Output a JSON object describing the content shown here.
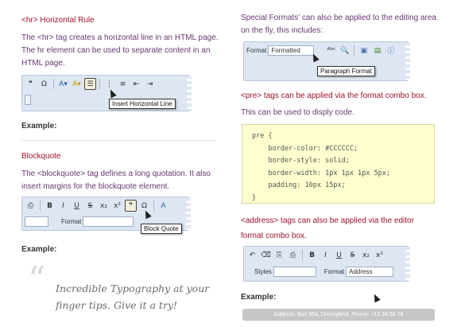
{
  "left": {
    "hr": {
      "heading": "<hr> Horizontal Rule",
      "para1": "The <hr> tag creates a horizontal line in an HTML page.",
      "para2": "The hr element can be used to separate content in an",
      "para3": "HTML page.",
      "tooltip": "Insert Horizontal Line",
      "example": "Example:"
    },
    "blockquote": {
      "heading": "Blockquote",
      "para1": "The <blockquote> tag defines a long quotation. It also",
      "para2": "insert margins for the blockquote element.",
      "format_label": "Format",
      "tooltip": "Block Quote",
      "example": "Example:"
    },
    "quote": {
      "mark": "“",
      "line1": "Incredible Typography at your",
      "line2": "finger tips. Give it a try!"
    }
  },
  "right": {
    "special": {
      "para1": "Special Formats' can also be applied to the editing area",
      "para2": "on the fly, this includes:",
      "format_label": "Format",
      "format_value": "Formatted",
      "tooltip": "Paragraph Format"
    },
    "pre": {
      "heading": "<pre> tags can be applied via the format combo box.",
      "para": "This can be used to disply code.",
      "code": [
        "pre {",
        "    border-color: #CCCCCC;",
        "    border-style: solid;",
        "    border-width: 1px 1px 1px 5px;",
        "    padding: 10px 15px;",
        "}"
      ]
    },
    "address": {
      "heading1": "<address> tags can also be applied via the editor",
      "heading2": "format combo box.",
      "styles_label": "Styles",
      "format_label": "Format",
      "format_value": "Address",
      "example": "Example:",
      "bar_text": "Address: Box 564, Disneyland, Phone: +12 34 56 78"
    }
  },
  "colors": {
    "heading": "#a0112a",
    "para": "#6a3574",
    "code_bg": "#fefecf",
    "toolbar_bg": "#dde6f2"
  }
}
